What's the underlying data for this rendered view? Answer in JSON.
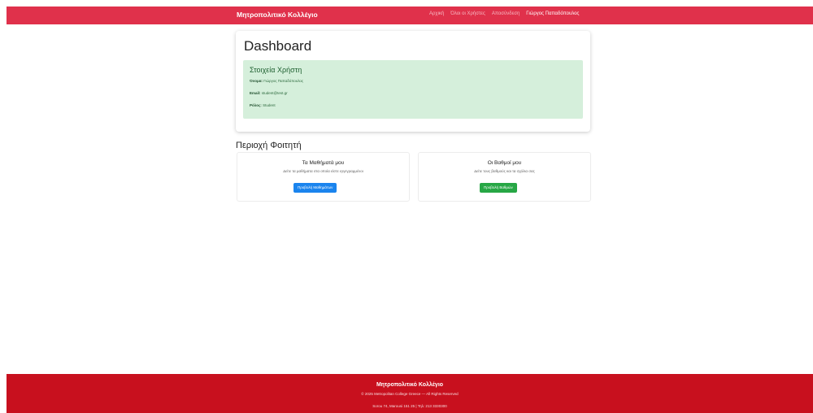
{
  "header": {
    "brand": "Μητροπολιτικό Κολλέγιο",
    "nav": [
      "Αρχική",
      "Όλοι οι Χρήστες",
      "Αποσύνδεση"
    ],
    "user": "Γιώργος Παπαδόπουλος",
    "bar_color": "#e0314b"
  },
  "dashboard": {
    "title": "Dashboard",
    "info": {
      "heading": "Στοιχεία Χρήστη",
      "name_label": "Όνομα:",
      "name_value": "Γιώργος Παπαδόπουλος",
      "email_label": "Email:",
      "email_value": "student@test.gr",
      "role_label": "Ρόλος:",
      "role_value": "Student"
    }
  },
  "student_area": {
    "title": "Περιοχή Φοιτητή",
    "cards": [
      {
        "title": "Τα Μαθήματά μου",
        "description": "Δείτε τα μαθήματα στα οποία είστε εγγεγραμμένοι",
        "button": "Προβολή Μαθημάτων",
        "button_color": "#1a84ee"
      },
      {
        "title": "Οι Βαθμοί μου",
        "description": "Δείτε τους βαθμούς και τα σχόλια σας",
        "button": "Προβολή Βαθμών",
        "button_color": "#27a745"
      }
    ]
  },
  "footer": {
    "title": "Μητροπολιτικό Κολλέγιο",
    "copyright": "© 2025 Metropolitan College Greece — All Rights Reserved",
    "address": "Sorou 74, Marousi 151 25 | Τηλ: 213 3330300",
    "bar_color": "#c8101e"
  }
}
